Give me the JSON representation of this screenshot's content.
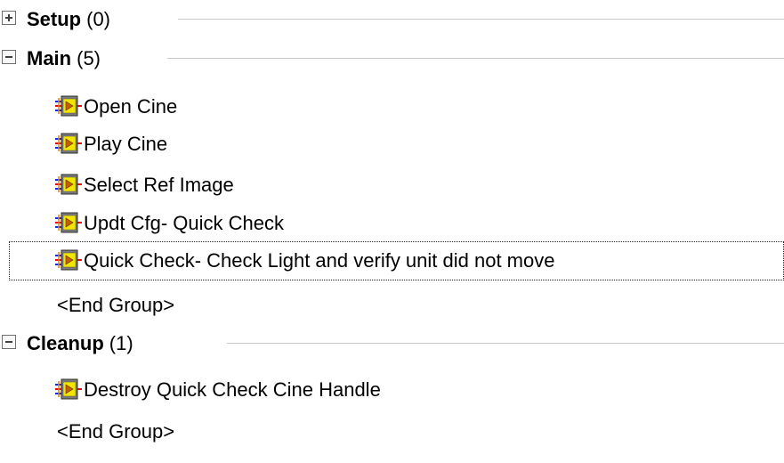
{
  "groups": [
    {
      "name": "Setup",
      "count": "(0)",
      "expanded": false,
      "steps": [],
      "end_label": ""
    },
    {
      "name": "Main",
      "count": "(5)",
      "expanded": true,
      "steps": [
        {
          "label": "Open Cine"
        },
        {
          "label": "Play Cine"
        },
        {
          "label": "Select Ref Image"
        },
        {
          "label": "Updt Cfg- Quick Check"
        },
        {
          "label": "Quick Check- Check Light and verify unit did not move",
          "selected": true
        }
      ],
      "end_label": "<End Group>"
    },
    {
      "name": "Cleanup",
      "count": "(1)",
      "expanded": true,
      "steps": [
        {
          "label": "Destroy Quick Check Cine Handle"
        }
      ],
      "end_label": "<End Group>"
    }
  ],
  "icons": {
    "expand": "plus-box-icon",
    "collapse": "minus-box-icon",
    "step": "vi-step-icon"
  },
  "colors": {
    "icon_fill": "#f2e600",
    "icon_border": "#303030",
    "wire_red": "#e01010",
    "wire_blue": "#1030d0",
    "wire_orange": "#f07800"
  }
}
